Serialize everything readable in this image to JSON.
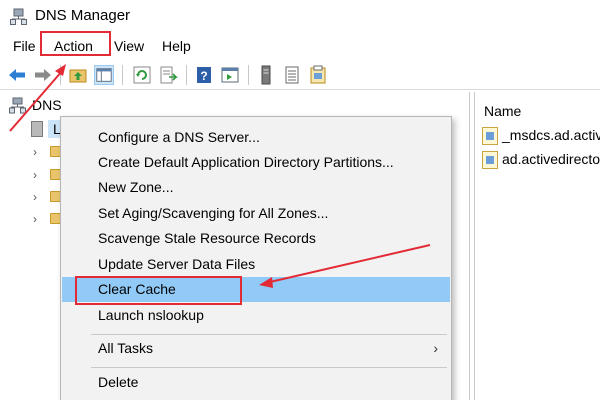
{
  "window": {
    "title": "DNS Manager",
    "icon": "dns-manager-icon"
  },
  "menu": {
    "file": "File",
    "action": "Action",
    "view": "View",
    "help": "Help"
  },
  "toolbar": {
    "icons": [
      "back-arrow-icon",
      "forward-arrow-icon",
      "up-folder-icon",
      "show-hide-console-tree-icon",
      "refresh-icon",
      "export-list-icon",
      "help-icon",
      "show-hide-action-pane-icon",
      "server-icon",
      "list-icon",
      "properties-icon"
    ]
  },
  "tree": {
    "root_label": "DNS",
    "server_label": "L"
  },
  "right_pane": {
    "column_header": "Name",
    "zones": [
      "_msdcs.ad.active",
      "ad.activedirector"
    ]
  },
  "context_menu": {
    "items": [
      "Configure a DNS Server...",
      "Create Default Application Directory Partitions...",
      "New Zone...",
      "Set Aging/Scavenging for All Zones...",
      "Scavenge Stale Resource Records",
      "Update Server Data Files",
      "Clear Cache",
      "Launch nslookup"
    ],
    "all_tasks": "All Tasks",
    "delete": "Delete",
    "highlighted_item": "Clear Cache"
  },
  "colors": {
    "highlight": "#91c9f7",
    "annotation": "#e32b36",
    "menu_bg": "#f2f2f2"
  }
}
